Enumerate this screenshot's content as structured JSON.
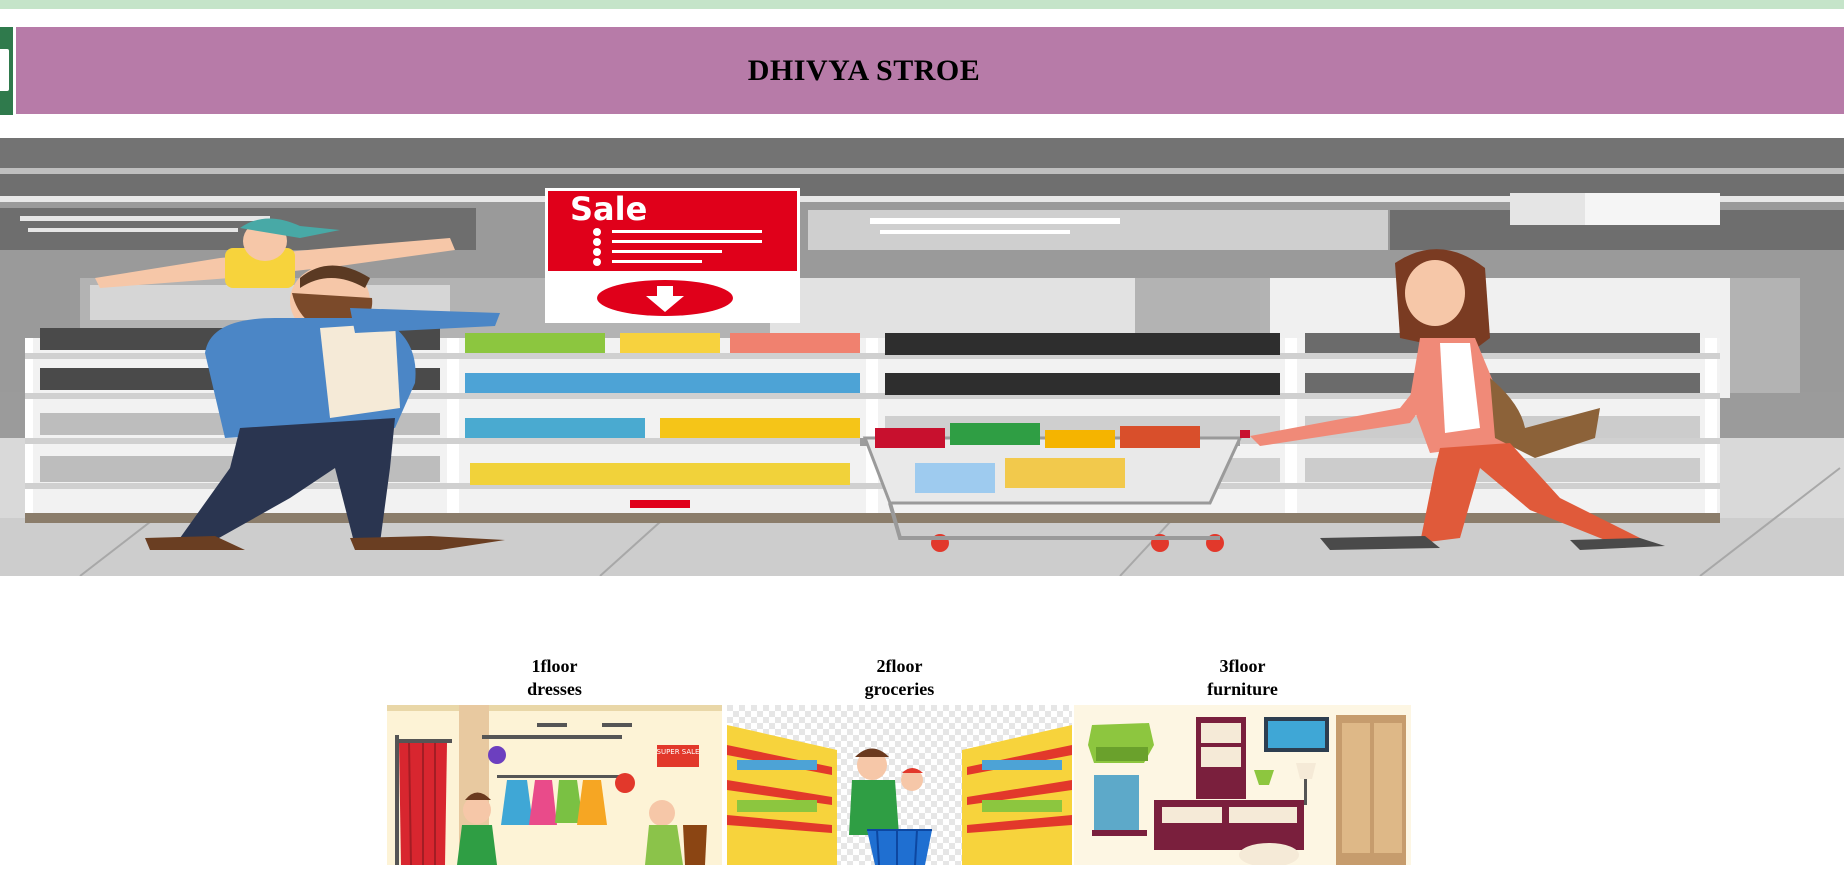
{
  "header": {
    "title": "DHIVYA STROE"
  },
  "hero": {
    "sale_sign": "Sale"
  },
  "floors": [
    {
      "level": "1floor",
      "category": "dresses",
      "thumb_sign": "SUPER SALE"
    },
    {
      "level": "2floor",
      "category": "groceries"
    },
    {
      "level": "3floor",
      "category": "furniture"
    }
  ],
  "colors": {
    "top_strip": "#c5e4c9",
    "side_tab": "#2f7a4c",
    "header_bg": "#b77ba8",
    "sale_red": "#e0001a"
  }
}
